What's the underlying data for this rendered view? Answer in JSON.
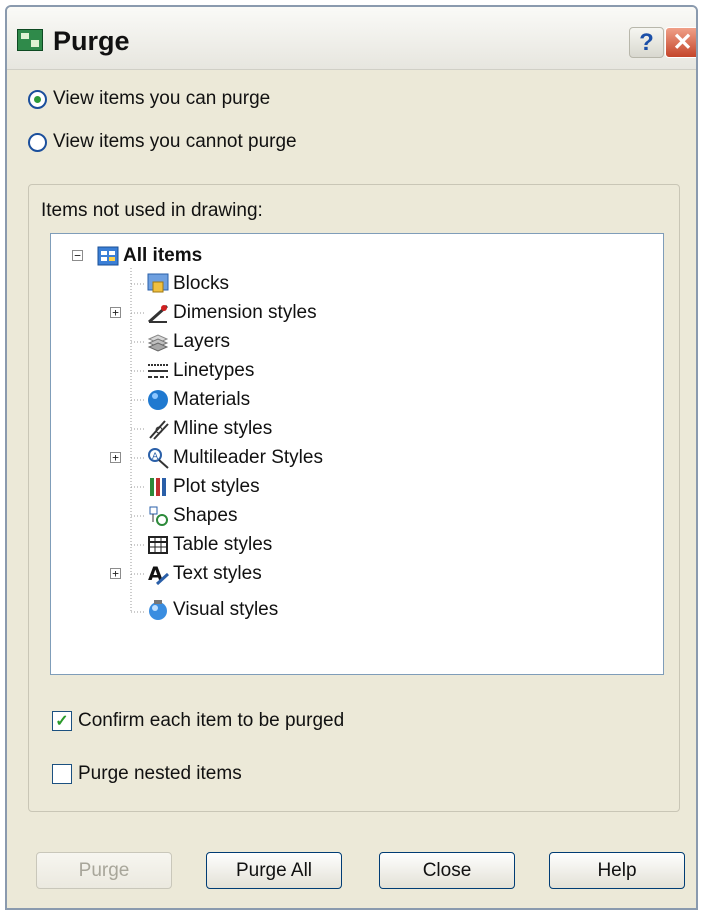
{
  "window": {
    "title": "Purge",
    "help_button": "?",
    "close_button": "✕"
  },
  "view_options": [
    {
      "label": "View items you can purge",
      "selected": true
    },
    {
      "label": "View items you cannot purge",
      "selected": false
    }
  ],
  "tree": {
    "group_label": "Items not used in drawing:",
    "root": {
      "label": "All items",
      "expanded": true
    },
    "items": [
      {
        "label": "Blocks",
        "icon": "blocks-icon",
        "expandable": false
      },
      {
        "label": "Dimension styles",
        "icon": "dimension-styles-icon",
        "expandable": true
      },
      {
        "label": "Layers",
        "icon": "layers-icon",
        "expandable": false
      },
      {
        "label": "Linetypes",
        "icon": "linetypes-icon",
        "expandable": false
      },
      {
        "label": "Materials",
        "icon": "materials-icon",
        "expandable": false
      },
      {
        "label": "Mline styles",
        "icon": "mline-styles-icon",
        "expandable": false
      },
      {
        "label": "Multileader Styles",
        "icon": "multileader-styles-icon",
        "expandable": true
      },
      {
        "label": "Plot styles",
        "icon": "plot-styles-icon",
        "expandable": false
      },
      {
        "label": "Shapes",
        "icon": "shapes-icon",
        "expandable": false
      },
      {
        "label": "Table styles",
        "icon": "table-styles-icon",
        "expandable": false
      },
      {
        "label": "Text styles",
        "icon": "text-styles-icon",
        "expandable": true
      },
      {
        "label": "Visual styles",
        "icon": "visual-styles-icon",
        "expandable": false
      }
    ]
  },
  "options": {
    "confirm_each": {
      "label": "Confirm each item to be purged",
      "checked": true
    },
    "purge_nested": {
      "label": "Purge nested items",
      "checked": false
    }
  },
  "buttons": {
    "purge": {
      "label": "Purge",
      "enabled": false
    },
    "purge_all": {
      "label": "Purge All",
      "enabled": true
    },
    "close": {
      "label": "Close",
      "enabled": true
    },
    "help": {
      "label": "Help",
      "enabled": true
    }
  },
  "colors": {
    "dialog_bg": "#ece9d8",
    "radio_dot": "#2c9a3a",
    "check_mark": "#2a9a2a",
    "close_red": "#c4452a"
  }
}
